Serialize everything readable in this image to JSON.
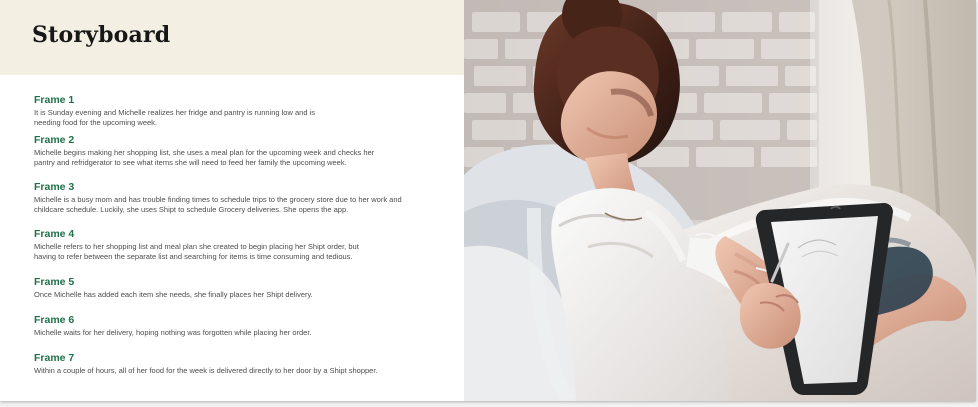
{
  "storyboard": {
    "title": "Storyboard",
    "frames": [
      {
        "label": "Frame 1",
        "text": "It is Sunday evening and Michelle realizes her fridge and pantry is running low and is needing food for the upcoming week."
      },
      {
        "label": "Frame 2",
        "text": "Michelle begins making her shopping list, she uses a meal plan for the upcoming week and checks her pantry and refridgerator to see what items she will need to feed her family the upcoming week."
      },
      {
        "label": "Frame 3",
        "text": "Michelle is a busy mom and has trouble finding times to schedule trips to the grocery store due to her work and childcare schedule. Luckily, she uses Shipt to schedule Grocery deliveries. She opens the app."
      },
      {
        "label": "Frame 4",
        "text": "Michelle refers to her shopping list and meal plan she created to begin placing her Shipt order, but having to refer between the separate list and searching for items is time consuming and tedious."
      },
      {
        "label": "Frame 5",
        "text": "Once Michelle has added each item she needs, she finally places her Shipt delivery."
      },
      {
        "label": "Frame 6",
        "text": "Michelle waits for her delivery, hoping nothing was forgotten while placing her order."
      },
      {
        "label": "Frame 7",
        "text": "Within a couple of hours, all of her food for the week is delivered directly to her door by a Shipt shopper."
      }
    ]
  },
  "colors": {
    "header_bg": "#f3efe3",
    "frame_title": "#1f7148",
    "body_text": "#4d4d4d",
    "title_text": "#171717"
  },
  "photo": {
    "subject": "woman-using-tablet"
  }
}
